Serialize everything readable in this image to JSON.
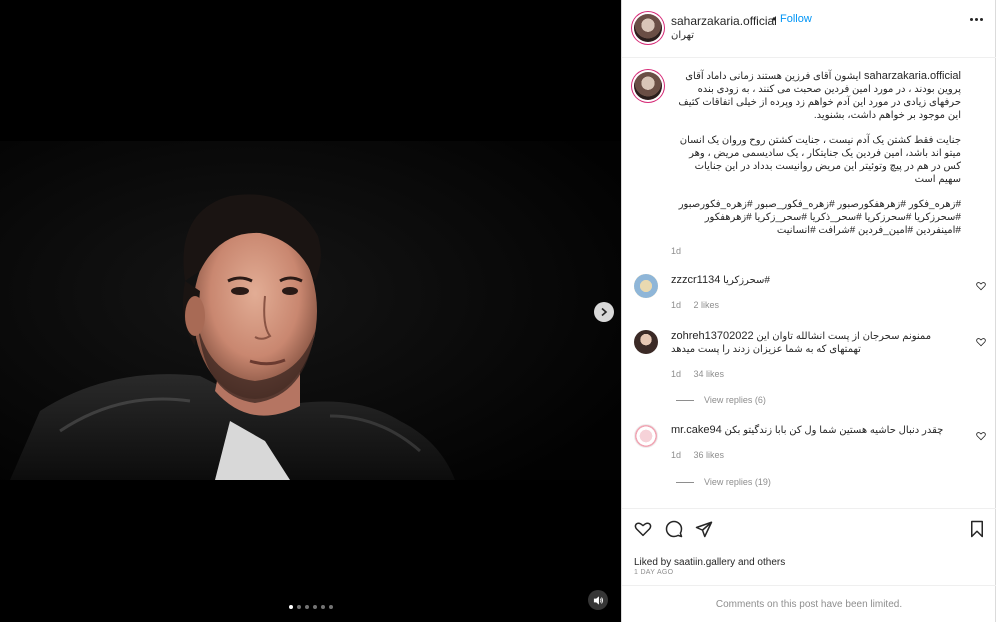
{
  "post": {
    "username": "saharzakaria.official",
    "follow_label": "Follow",
    "location": "تهران",
    "caption": {
      "username": "saharzakaria.official",
      "paragraph1": "ایشون آقای فرزین هستند زمانی داماد آقای پروین بودند ، در مورد امین فردین صحبت می کنند ، به زودی بنده حرفهای زیادی در مورد این آدم خواهم زد وپرده از خیلی اتفاقات کثیف این موجود بر خواهم داشت، بشنوید.",
      "paragraph2": "جنایت فقط کشتن یک آدم نیست ، جنایت کشتن روح وروان یک انسان میتو اند باشد، امین فردین یک جنایتکار ، یک سادیسمی مریض ، وهر کس در هم در پیچ وتوئیتر این مریض روانیست بدداد در این جنایات سهیم است",
      "hashtags": "#زهره_فکور #زهرهفکورصبور #زهره_فکور_صبور #زهره_فکورصبور #سحرزکریا #سحرزکریا #سحر_ذکریا #سحر_زکریا #زهرهفکور #امینفردین #امین_فردین #شرافت #انسانیت",
      "time": "1d"
    },
    "comments": [
      {
        "username": "zzzcr1134",
        "text": "#سحرزکریا",
        "time": "1d",
        "likes": "2 likes",
        "replies": ""
      },
      {
        "username": "zohreh13702022",
        "text": "ممنونم سحرجان از پست انشالله تاوان این تهمتهای که به شما عزیزان زدند را پست میدهد",
        "time": "1d",
        "likes": "34 likes",
        "replies": "View replies (6)"
      },
      {
        "username": "mr.cake94",
        "text": "چقدر دنبال حاشیه هستین شما ول کن بابا زندگیتو بکن",
        "time": "1d",
        "likes": "36 likes",
        "replies": "View replies (19)"
      }
    ],
    "liked_by_prefix": "Liked by ",
    "liked_by_user": "saatiin.gallery",
    "liked_by_suffix": " and others",
    "date": "1 DAY AGO",
    "comments_limited": "Comments on this post have been limited."
  },
  "media": {
    "carousel_count": 6,
    "carousel_active": 0
  }
}
